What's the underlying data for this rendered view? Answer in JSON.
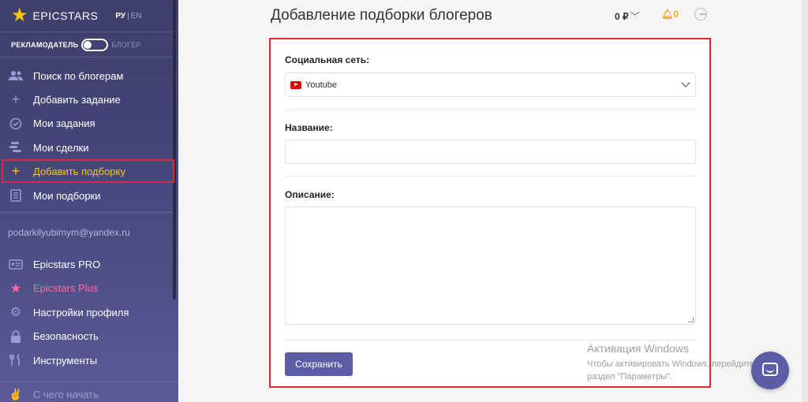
{
  "brand": {
    "name": "EPICSTARS",
    "lang_ru": "РУ",
    "lang_sep": "|",
    "lang_en": "EN"
  },
  "role": {
    "advertiser": "РЕКЛАМОДАТЕЛЬ",
    "blogger": "БЛОГЕР"
  },
  "sidebar": {
    "items": [
      {
        "label": "Поиск по блогерам"
      },
      {
        "label": "Добавить задание"
      },
      {
        "label": "Мои задания"
      },
      {
        "label": "Мои сделки"
      },
      {
        "label": "Добавить подборку"
      },
      {
        "label": "Мои подборки"
      }
    ],
    "email": "podarkilyubimym@yandex.ru",
    "account_items": [
      {
        "label": "Epicstars PRO"
      },
      {
        "label": "Epicstars Plus"
      },
      {
        "label": "Настройки профиля"
      },
      {
        "label": "Безопасность"
      },
      {
        "label": "Инструменты"
      }
    ],
    "bottom_item": "С чего начать"
  },
  "header": {
    "title": "Добавление подборки блогеров",
    "balance": "0 ₽",
    "notifications": "0"
  },
  "form": {
    "social_label": "Социальная сеть:",
    "social_value": "Youtube",
    "name_label": "Название:",
    "name_value": "",
    "description_label": "Описание:",
    "description_value": "",
    "save_label": "Сохранить"
  },
  "watermark": {
    "title": "Активация Windows",
    "line1": "Чтобы активировать Windows, перейдите в",
    "line2": "раздел \"Параметры\"."
  },
  "colors": {
    "accent": "#5b5ea6",
    "highlight": "#d32f3a",
    "active": "#f5c518",
    "plus": "#ff6aa1"
  }
}
